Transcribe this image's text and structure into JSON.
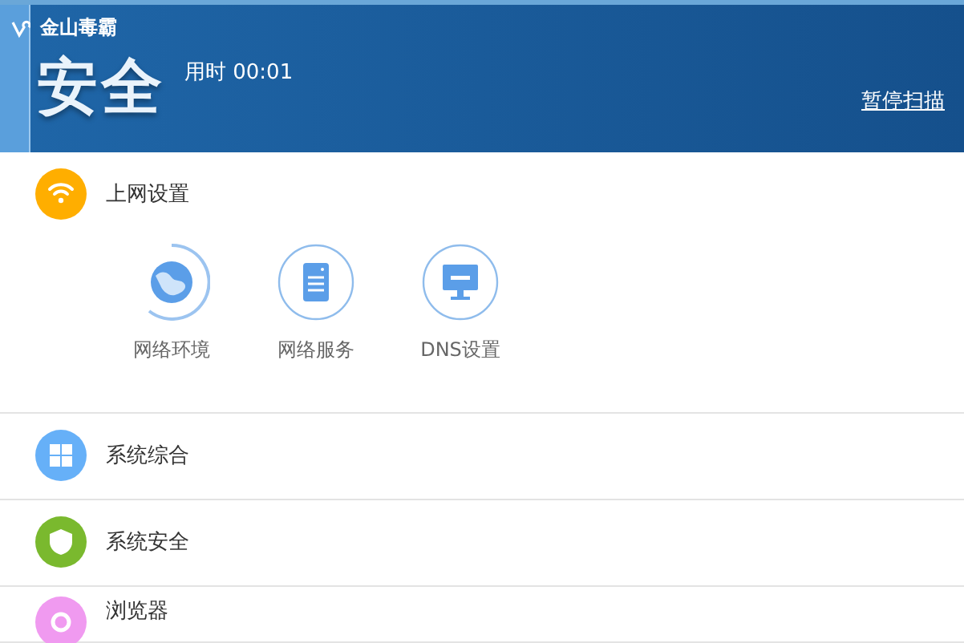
{
  "header": {
    "app_name": "金山毒霸",
    "status": "安全",
    "elapsed": "用时 00:01",
    "pause_link": "暂停扫描"
  },
  "sections": [
    {
      "kind": "wifi",
      "name": "上网设置",
      "color": "#ffae00",
      "items": [
        {
          "kind": "globe",
          "label": "网络环境",
          "scanning": true
        },
        {
          "kind": "server",
          "label": "网络服务",
          "scanning": false
        },
        {
          "kind": "monitor",
          "label": "DNS设置",
          "scanning": false
        }
      ]
    },
    {
      "kind": "windows",
      "name": "系统综合",
      "color": "#66b0f8"
    },
    {
      "kind": "shield",
      "name": "系统安全",
      "color": "#7ab92e"
    },
    {
      "kind": "browser",
      "name": "浏览器",
      "color": "#f09af0"
    }
  ]
}
